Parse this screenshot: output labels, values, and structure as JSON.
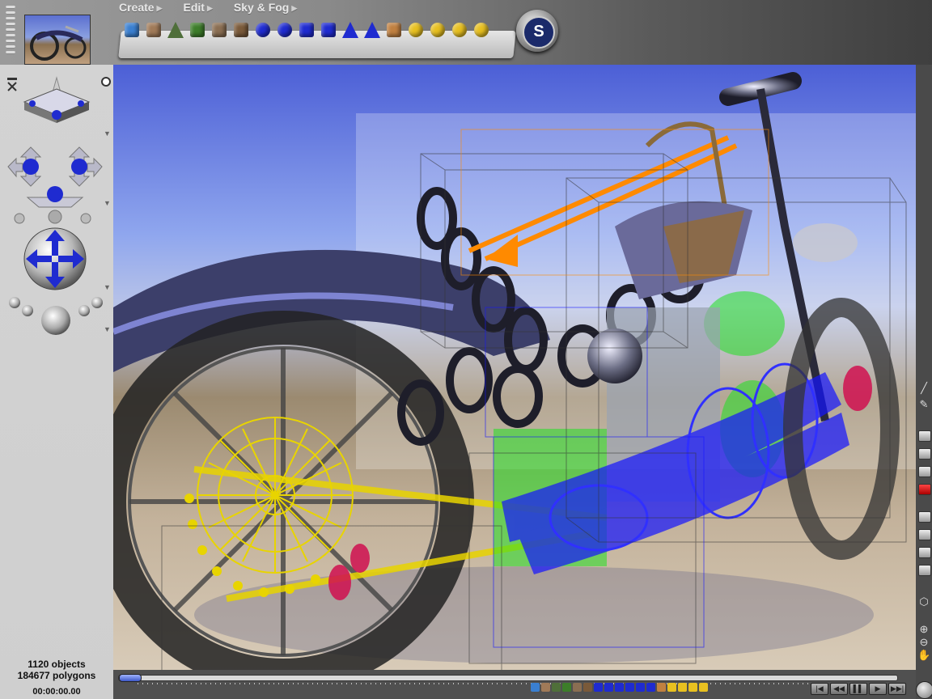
{
  "menu": [
    {
      "label": "Create"
    },
    {
      "label": "Edit"
    },
    {
      "label": "Sky & Fog"
    }
  ],
  "create_tray": [
    {
      "icon": "water-plane-icon",
      "color": "#3a7fd0"
    },
    {
      "icon": "ground-plane-icon",
      "color": "#a07a58"
    },
    {
      "icon": "terrain-icon",
      "color": "#4f6f3a"
    },
    {
      "icon": "tree-icon",
      "color": "#3d7d2a"
    },
    {
      "icon": "rock-icon",
      "color": "#8a6e52"
    },
    {
      "icon": "metablob-icon",
      "color": "#7a5a3a"
    },
    {
      "icon": "sphere-icon",
      "color": "#1f2bd0"
    },
    {
      "icon": "torus-icon",
      "color": "#1f2bd0"
    },
    {
      "icon": "cylinder-icon",
      "color": "#1f2bd0"
    },
    {
      "icon": "cube-icon",
      "color": "#1f2bd0"
    },
    {
      "icon": "cone-icon",
      "color": "#1f2bd0"
    },
    {
      "icon": "pyramid-icon",
      "color": "#1f2bd0"
    },
    {
      "icon": "figure-icon",
      "color": "#c08040"
    },
    {
      "icon": "light-icon",
      "color": "#e8c020"
    },
    {
      "icon": "spotlight-icon",
      "color": "#e8c020"
    },
    {
      "icon": "light-bulb-icon",
      "color": "#e8c020"
    },
    {
      "icon": "area-light-icon",
      "color": "#e8c020"
    }
  ],
  "stats": {
    "objects": "1120 objects",
    "polygons": "184677 polygons",
    "time": "00:00:00.00"
  },
  "bottom_prims": [
    "#3a7fd0",
    "#a07a58",
    "#4f6f3a",
    "#3d7d2a",
    "#8a6e52",
    "#7a5a3a",
    "#1f2bd0",
    "#1f2bd0",
    "#1f2bd0",
    "#1f2bd0",
    "#1f2bd0",
    "#1f2bd0",
    "#c08040",
    "#e8c020",
    "#e8c020",
    "#e8c020",
    "#e8c020"
  ],
  "transport": [
    "|◀",
    "◀◀",
    "▌▌",
    "▶",
    "▶▶|"
  ],
  "colors": {
    "accent": "#1f2bd0",
    "wire_yellow": "#e8d400",
    "wire_blue": "#1414ff",
    "wire_green": "#22e022",
    "wire_orange": "#ff8a00",
    "wire_red": "#d01050"
  }
}
